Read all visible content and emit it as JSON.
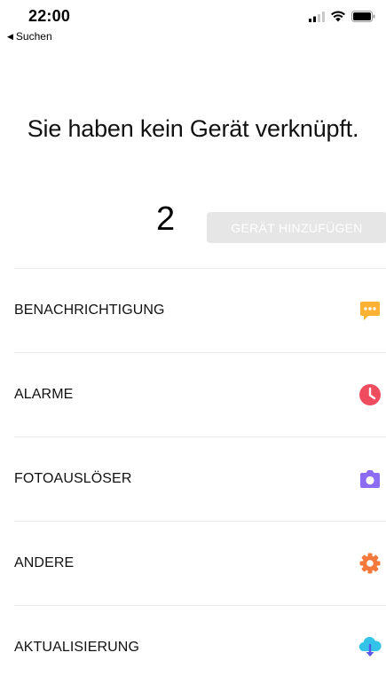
{
  "status_bar": {
    "time": "22:00",
    "back_label": "Suchen"
  },
  "title": "Sie haben kein Gerät verknüpft.",
  "device": {
    "count": "2",
    "add_button_label": "GERÄT HINZUFÜGEN"
  },
  "menu": {
    "items": [
      {
        "label": "BENACHRICHTIGUNG",
        "icon": "chat-bubble-icon",
        "color": "#f9b233"
      },
      {
        "label": "ALARME",
        "icon": "clock-icon",
        "color": "#ef4d5f"
      },
      {
        "label": "FOTOAUSLÖSER",
        "icon": "camera-icon",
        "color": "#8b6cf2"
      },
      {
        "label": "ANDERE",
        "icon": "gear-icon",
        "color": "#f4793b"
      },
      {
        "label": "AKTUALISIERUNG",
        "icon": "cloud-download-icon",
        "color": "#33c3e8"
      }
    ]
  }
}
